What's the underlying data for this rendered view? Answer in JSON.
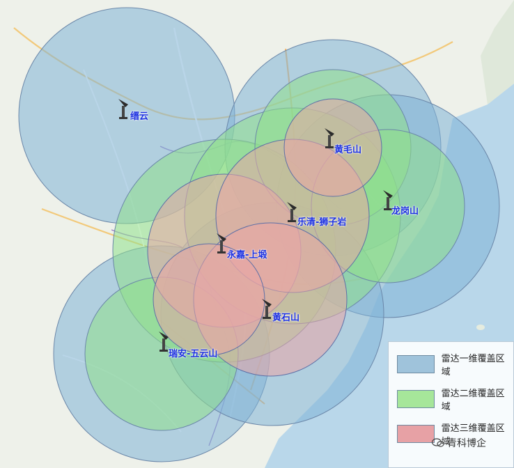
{
  "map": {
    "colors": {
      "sea": "#b9d7ea",
      "land": "#eef1ea",
      "coverage_1d": "#7fb3d6",
      "coverage_2d": "#8fe08a",
      "coverage_3d": "#e9a6a6",
      "label": "#1b2fe0"
    }
  },
  "stations": [
    {
      "name": "缙云"
    },
    {
      "name": "黄毛山"
    },
    {
      "name": "龙岗山"
    },
    {
      "name": "乐清-狮子岩"
    },
    {
      "name": "永嘉-上塅"
    },
    {
      "name": "黄石山"
    },
    {
      "name": "瑞安-五云山"
    }
  ],
  "legend": {
    "items": [
      {
        "label": "雷达一维覆盖区域",
        "color": "#9fc3db"
      },
      {
        "label": "雷达二维覆盖区域",
        "color": "#a6e69a"
      },
      {
        "label": "雷达三维覆盖区域",
        "color": "#e7a1a5"
      }
    ]
  },
  "watermark": {
    "text": "青科博企",
    "icon": "wechat-icon"
  }
}
